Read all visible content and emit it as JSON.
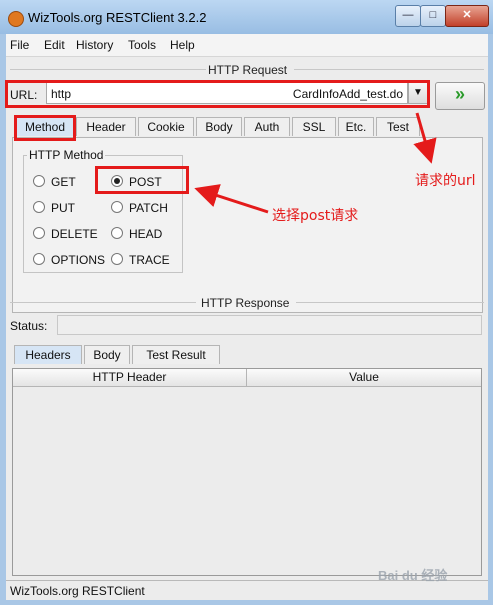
{
  "window": {
    "title": "WizTools.org RESTClient 3.2.2",
    "min_label": "—",
    "max_label": "□",
    "close_label": "✕"
  },
  "menu": [
    {
      "label": "File"
    },
    {
      "label": "Edit"
    },
    {
      "label": "History"
    },
    {
      "label": "Tools"
    },
    {
      "label": "Help"
    }
  ],
  "request": {
    "title": "HTTP Request",
    "url_label": "URL:",
    "url_left": "http",
    "url_right": "CardInfoAdd_test.do",
    "go_label": "»",
    "tabs": [
      {
        "label": "Method"
      },
      {
        "label": "Header"
      },
      {
        "label": "Cookie"
      },
      {
        "label": "Body"
      },
      {
        "label": "Auth"
      },
      {
        "label": "SSL"
      },
      {
        "label": "Etc."
      },
      {
        "label": "Test"
      }
    ],
    "method_group_title": "HTTP Method",
    "methods": [
      {
        "label": "GET"
      },
      {
        "label": "POST"
      },
      {
        "label": "PUT"
      },
      {
        "label": "PATCH"
      },
      {
        "label": "DELETE"
      },
      {
        "label": "HEAD"
      },
      {
        "label": "OPTIONS"
      },
      {
        "label": "TRACE"
      }
    ],
    "selected_method": "POST"
  },
  "response": {
    "title": "HTTP Response",
    "status_label": "Status:",
    "tabs": [
      {
        "label": "Headers"
      },
      {
        "label": "Body"
      },
      {
        "label": "Test Result"
      }
    ],
    "columns": [
      {
        "label": "HTTP Header"
      },
      {
        "label": "Value"
      }
    ]
  },
  "statusbar": {
    "text": "WizTools.org RESTClient"
  },
  "annotations": {
    "url_note": "请求的url",
    "post_note": "选择post请求"
  },
  "watermark": "Bai du 经验",
  "colors": {
    "annotation": "#e41b1b",
    "active_tab": "#d6e5f5",
    "go_arrow": "#2a9a2a"
  }
}
